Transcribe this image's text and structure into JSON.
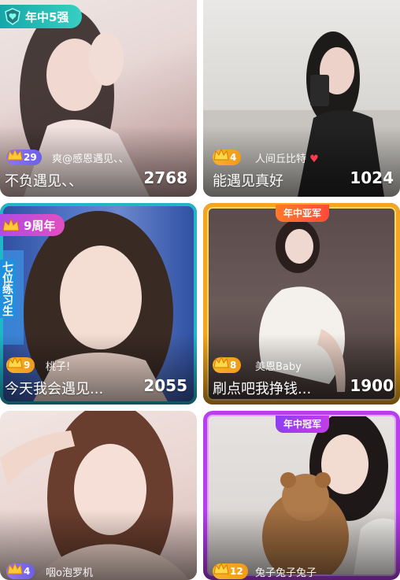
{
  "cards": [
    {
      "badge": "年中5强",
      "level": "29",
      "nick": "爽@感恩遇见、、",
      "title": "不负遇见、、",
      "count": "2768"
    },
    {
      "level": "4",
      "nick": "人间丘比特",
      "title": "能遇见真好",
      "count": "1024"
    },
    {
      "badge": "9周年",
      "side_text": "七位练习生",
      "level": "9",
      "nick": "桃子!",
      "title": "今天我会遇见...",
      "count": "2055"
    },
    {
      "banner": "年中亚军",
      "level": "8",
      "nick": "美恩Baby",
      "title": "刷点吧我挣钱...",
      "count": "1900"
    },
    {
      "level": "4",
      "nick": "咽o泡罗机"
    },
    {
      "banner": "年中冠军",
      "level": "12",
      "nick": "兔子兔子兔子"
    }
  ],
  "colors": {
    "level_gold": "#f0a020",
    "level_purple": "#8a6cf0",
    "teal": "#19b3b8",
    "champion_purple": "#b63cf0",
    "runnerup_orange": "#f08c1e"
  }
}
